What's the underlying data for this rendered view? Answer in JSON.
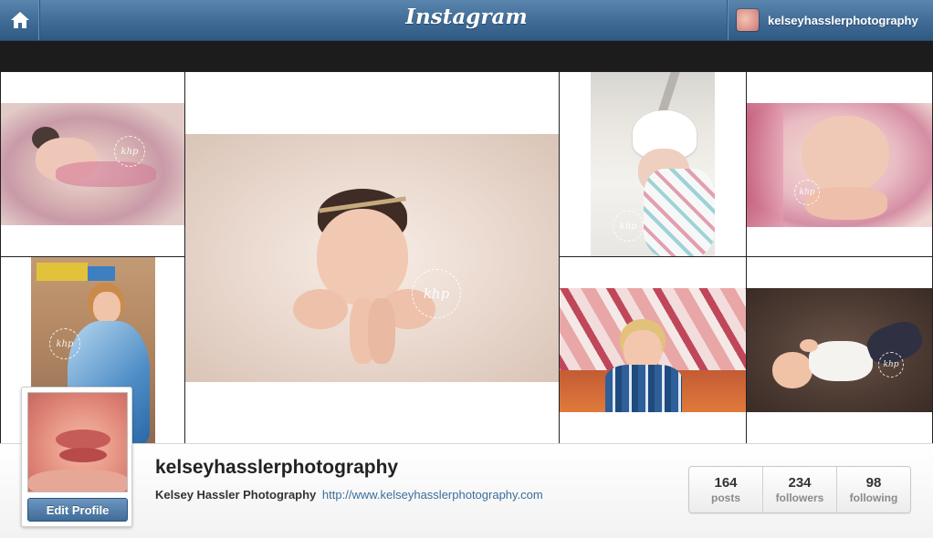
{
  "header": {
    "brand": "Instagram",
    "username": "kelseyhasslerphotography"
  },
  "grid": {
    "watermark": "khp",
    "photos": [
      {
        "subject": "newborn-in-pink-nest"
      },
      {
        "subject": "newborn-with-headband-featured"
      },
      {
        "subject": "newborn-in-white-hat"
      },
      {
        "subject": "newborn-wrapped-pink-blanket"
      },
      {
        "subject": "toddler-in-blue-dress"
      },
      {
        "subject": "toddler-under-quilt-tent"
      },
      {
        "subject": "baby-in-suspenders-lying"
      }
    ]
  },
  "profile": {
    "username": "kelseyhasslerphotography",
    "full_name": "Kelsey Hassler Photography",
    "website": "http://www.kelseyhasslerphotography.com",
    "edit_label": "Edit Profile",
    "stats": [
      {
        "value": "164",
        "label": "posts"
      },
      {
        "value": "234",
        "label": "followers"
      },
      {
        "value": "98",
        "label": "following"
      }
    ]
  },
  "colors": {
    "topbar": "#3f6b96",
    "link": "#3a6e9e",
    "edit_button": "#4f7cab"
  }
}
